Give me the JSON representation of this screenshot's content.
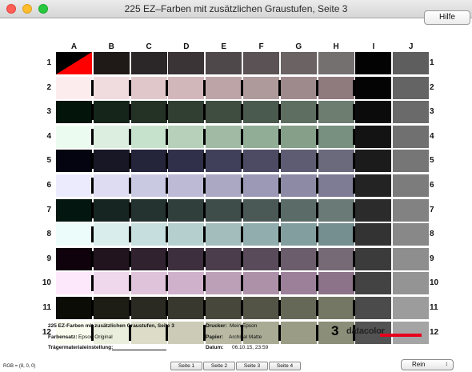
{
  "window": {
    "title": "225 EZ–Farben mit zusätzlichen Graustufen, Seite 3"
  },
  "toolbar": {
    "help_label": "Hilfe"
  },
  "grid": {
    "columns": [
      "A",
      "B",
      "C",
      "D",
      "E",
      "F",
      "G",
      "H",
      "I",
      "J"
    ],
    "rows": [
      "1",
      "2",
      "3",
      "4",
      "5",
      "6",
      "7",
      "8",
      "9",
      "10",
      "11",
      "12"
    ],
    "colors": [
      [
        "#000000",
        "#1f1918",
        "#2b2627",
        "#3b3436",
        "#4f484a",
        "#5a5254",
        "#6a6263",
        "#757070",
        "#030303",
        "#5e5e5e"
      ],
      [
        "#fdecee",
        "#f0dcdf",
        "#e0c8ca",
        "#d2b7ba",
        "#bda5a7",
        "#ae9a9b",
        "#9e8a8c",
        "#8f7a7e",
        "#040404",
        "#646464"
      ],
      [
        "#03150a",
        "#152519",
        "#243226",
        "#313f32",
        "#3f4d40",
        "#4b5a4e",
        "#5e6e61",
        "#6d7d70",
        "#0b0b0b",
        "#6a6a6a"
      ],
      [
        "#ecfbef",
        "#dbeedf",
        "#c7e2cc",
        "#b6d0ba",
        "#a1baa4",
        "#92ad96",
        "#859f88",
        "#779080",
        "#131313",
        "#707070"
      ],
      [
        "#040410",
        "#171726",
        "#24243b",
        "#31304a",
        "#41405a",
        "#4c4b63",
        "#5d5c72",
        "#6b6a7d",
        "#1b1b1b",
        "#767676"
      ],
      [
        "#ecebfe",
        "#dddcf3",
        "#cac9e2",
        "#bcbad5",
        "#aaa8c2",
        "#9b99b5",
        "#8c8aa4",
        "#7e7c94",
        "#232323",
        "#7c7c7c"
      ],
      [
        "#041610",
        "#162521",
        "#24332f",
        "#313f3c",
        "#3e4d4a",
        "#4a5956",
        "#5a6b68",
        "#697a77",
        "#2b2b2b",
        "#828282"
      ],
      [
        "#ebfcfb",
        "#d9eded",
        "#c6dedd",
        "#b4cfce",
        "#a2bdbc",
        "#92adad",
        "#839e9f",
        "#758f91",
        "#333333",
        "#888888"
      ],
      [
        "#10020d",
        "#22141f",
        "#312230",
        "#3e2f3e",
        "#4c3d4c",
        "#5a4b5b",
        "#6b5d6b",
        "#776a77",
        "#3b3b3b",
        "#8e8e8e"
      ],
      [
        "#fde7fb",
        "#efd8eb",
        "#dfc3da",
        "#cfb1cc",
        "#bba0b7",
        "#ad91a9",
        "#9c809a",
        "#8c7389",
        "#434343",
        "#949494"
      ],
      [
        "#0b0c05",
        "#1d1d15",
        "#2a2a22",
        "#38382e",
        "#47473c",
        "#535446",
        "#656857",
        "#737763",
        "#4b4b4b",
        "#9c9c9c"
      ],
      [
        "#fafcef",
        "#eaeedc",
        "#dcdcc8",
        "#cccbb7",
        "#b9b9a4",
        "#a9ab95",
        "#9a9c86",
        "#8b8e78",
        "#535353",
        "#a4a4a4"
      ]
    ],
    "corner_accent_color": "#ff0000"
  },
  "info": {
    "heading": "225 EZ-Farben mit zusätzlichen Graustufen, Seite 3",
    "farbensatz_label": "Farbensatz:",
    "farbensatz_value": "Epson Original",
    "traeger_label": "Trägermaterialeinstellung:",
    "drucker_label": "Drucker:",
    "drucker_value": "Mein Epson",
    "papier_label": "Papier:",
    "papier_value": "Archival Matte",
    "datum_label": "Datum:",
    "datum_value": "06.10.15, 23:59",
    "page_number": "3",
    "logo_text": "datacolor"
  },
  "status": {
    "rgb_text": "RGB = (8, 0, 0)"
  },
  "pages": [
    "Seite 1",
    "Seite 2",
    "Seite 3",
    "Seite 4"
  ],
  "select": {
    "value": "Rein"
  }
}
